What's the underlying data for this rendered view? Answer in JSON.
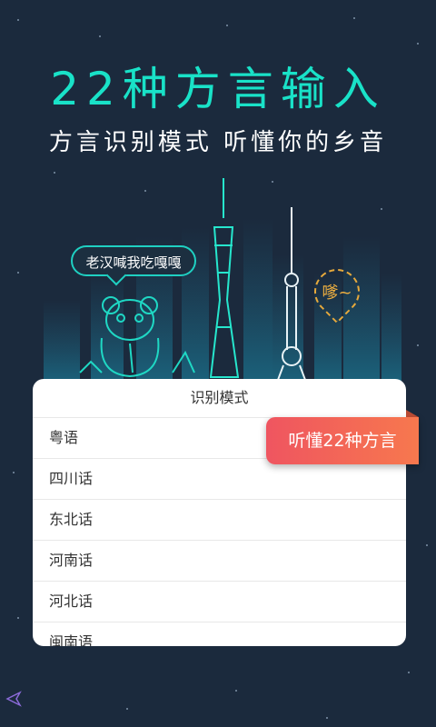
{
  "hero": {
    "title": "22种方言输入",
    "subtitle": "方言识别模式  听懂你的乡音"
  },
  "illustration": {
    "speech_bubble": "老汉喊我吃嘎嘎",
    "pin_text": "嗲~"
  },
  "dialog": {
    "title": "识别模式",
    "options": [
      "粤语",
      "四川话",
      "东北话",
      "河南话",
      "河北话",
      "闽南语"
    ]
  },
  "badge": {
    "label": "听懂22种方言"
  },
  "colors": {
    "background": "#1b2a3d",
    "accent": "#19e2c8",
    "badge": "#ef5560",
    "pin": "#e6a93c"
  },
  "icons": {
    "nav_back": "triangle-left-icon",
    "mascot": "panda-icon"
  }
}
